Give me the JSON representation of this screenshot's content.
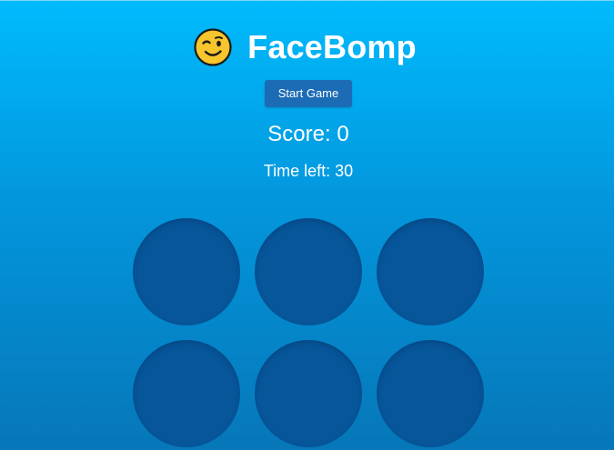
{
  "game": {
    "title": "FaceBomp",
    "logo_icon": "winking-face-emoji",
    "start_button_label": "Start Game",
    "score_text": "Score: 0",
    "timer_text": "Time left: 30"
  },
  "board": {
    "rows": 2,
    "columns": 3,
    "holes": [
      "hole-1",
      "hole-2",
      "hole-3",
      "hole-4",
      "hole-5",
      "hole-6"
    ]
  },
  "colors": {
    "background_top": "#00bbfd",
    "background_bottom": "#0677b8",
    "button": "#1b6cb5",
    "hole": "#07569a",
    "text": "#ffffff"
  }
}
